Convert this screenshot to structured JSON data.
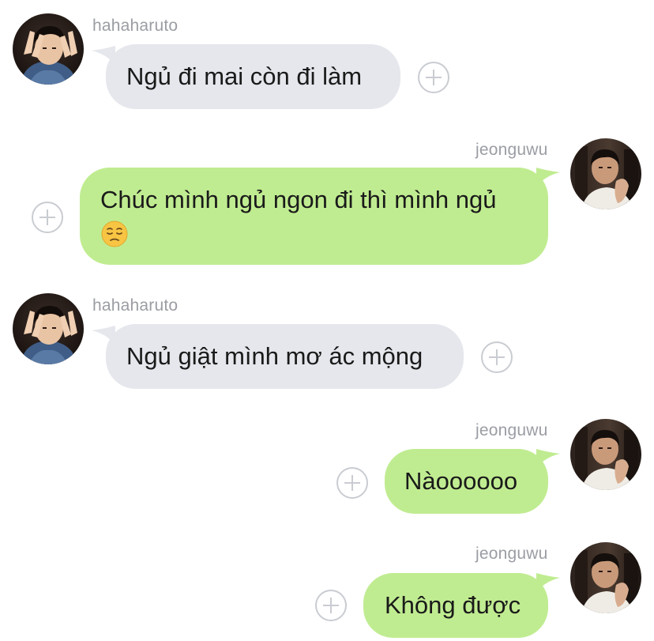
{
  "messages": [
    {
      "sender": "hahaharuto",
      "text": "Ngủ đi mai còn đi làm",
      "side": "received"
    },
    {
      "sender": "jeonguwu",
      "text": "Chúc mình ngủ ngon đi thì mình ngủ",
      "emoji": "pensive-face",
      "side": "sent"
    },
    {
      "sender": "hahaharuto",
      "text": "Ngủ giật mình mơ ác mộng",
      "side": "received"
    },
    {
      "sender": "jeonguwu",
      "text": "Nàoooooo",
      "side": "sent"
    },
    {
      "sender": "jeonguwu",
      "text": "Không được",
      "side": "sent"
    }
  ],
  "colors": {
    "received_bubble": "#e5e7ec",
    "sent_bubble": "#c0ec91",
    "sender_name": "#9a9da3",
    "add_icon": "#c9ccd1"
  }
}
